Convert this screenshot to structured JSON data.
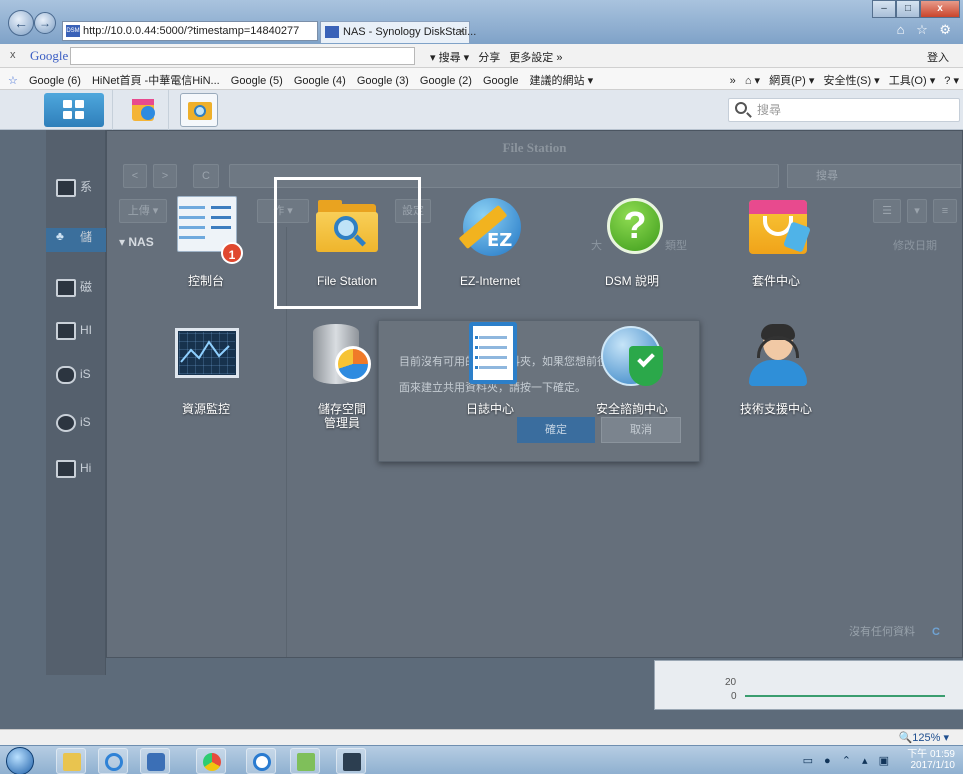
{
  "browser": {
    "address_url": "http://10.0.0.44:5000/?timestamp=14840277",
    "tab_title": "NAS - Synology DiskStati...",
    "tab_close": "×",
    "back_glyph": "←",
    "forward_glyph": "→",
    "win_min": "–",
    "win_max": "□",
    "win_close": "x",
    "right_icons": "⌂ ☆ ⚙"
  },
  "google_bar": {
    "close": "x",
    "logo": "Google",
    "search_btn": "▾ 搜尋 ▾",
    "share": "分享",
    "more": "更多設定 »",
    "login": "登入"
  },
  "favorites": {
    "items": [
      "Google (6)",
      "HiNet首頁 -中華電信HiN...",
      "Google (5)",
      "Google (4)",
      "Google (3)",
      "Google (2)",
      "Google",
      "建議的網站 ▾"
    ],
    "right_tools": [
      "»",
      "⌂ ▾",
      "網頁(P) ▾",
      "安全性(S) ▾",
      "工具(O) ▾",
      "? ▾"
    ]
  },
  "dsm_taskbar": {
    "search_placeholder": "搜尋"
  },
  "file_station_window": {
    "title": "File Station",
    "back": "<",
    "forward": ">",
    "refresh": "C",
    "search_placeholder": "搜尋",
    "toolbar": [
      "上傳 ▾",
      "作 ▾",
      "設定"
    ],
    "tree_root": "▾ NAS",
    "columns": [
      "大",
      "類型",
      "修改日期"
    ],
    "empty_text": "沒有任何資料",
    "empty_refresh": "C"
  },
  "left_panel_items": [
    {
      "label": "系"
    },
    {
      "label": "儲"
    },
    {
      "label": "磁"
    },
    {
      "label": "HI"
    },
    {
      "label": "iS"
    },
    {
      "label": "iS"
    },
    {
      "label": "Hi"
    }
  ],
  "dialog": {
    "line1": "目前沒有可用的共用資料夾，如果您想前往設定頁",
    "line2": "面來建立共用資料夾，請按一下確定。",
    "ok": "確定",
    "cancel": "取消"
  },
  "apps": [
    {
      "label": "控制台",
      "badge": "1"
    },
    {
      "label": "File Station"
    },
    {
      "label": "EZ-Internet",
      "icon_text": "EZ"
    },
    {
      "label": "DSM 說明",
      "icon_text": "?"
    },
    {
      "label": "套件中心"
    },
    {
      "label": "資源監控"
    },
    {
      "label": "儲存空間\n管理員"
    },
    {
      "label": "日誌中心"
    },
    {
      "label": "安全諮詢中心"
    },
    {
      "label": "技術支援中心"
    }
  ],
  "widget": {
    "y_top": "20",
    "y_bottom": "0"
  },
  "status": {
    "zoom": "🔍125% ▾"
  },
  "windows_tray": {
    "time": "下午 01:59",
    "date": "2017/1/10"
  }
}
